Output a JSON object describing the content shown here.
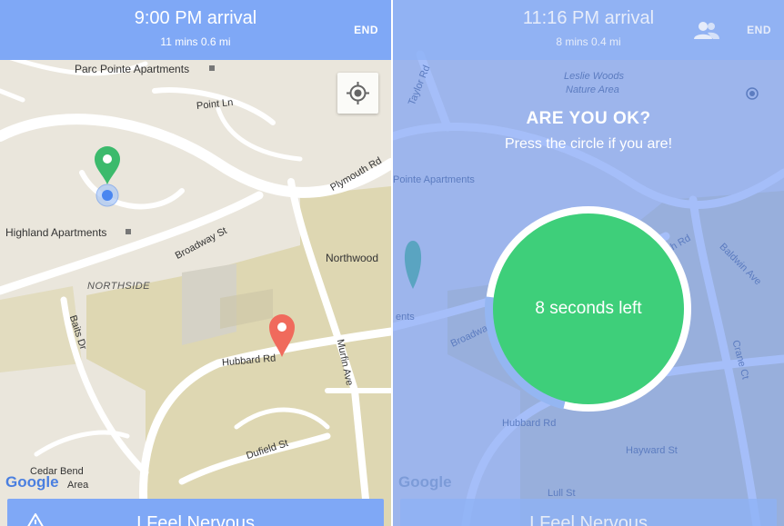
{
  "left": {
    "header": {
      "arrival": "9:00 PM arrival",
      "meta": "11 mins 0.6 mi",
      "end_label": "END"
    },
    "map_labels": {
      "parc_pointe": "Parc Pointe Apartments",
      "point_ln": "Point Ln",
      "plymouth_rd": "Plymouth Rd",
      "highland": "Highland Apartments",
      "broadway": "Broadway St",
      "northwood": "Northwood",
      "northside": "NORTHSIDE",
      "baits": "Baits Dr",
      "hubbard": "Hubbard Rd",
      "murfin": "Murfin Ave",
      "dufield": "Dufield St",
      "cedar_bend_1": "Cedar Bend",
      "cedar_bend_2": "Area"
    },
    "bottom": {
      "label": "I Feel Nervous"
    }
  },
  "right": {
    "header": {
      "arrival": "11:16 PM arrival",
      "meta": "8 mins 0.4 mi",
      "end_label": "END"
    },
    "map_labels": {
      "leslie_1": "Leslie Woods",
      "leslie_2": "Nature Area",
      "pointe": "Pointe Apartments",
      "taylor": "Taylor Rd",
      "hubbard": "Hubbard Rd",
      "hayward": "Hayward St",
      "broadway": "Broadway",
      "ents": "ents",
      "baldwin": "Baldwin Ave",
      "crane": "Crane Ct",
      "th_rd": "th Rd",
      "lull": "Lull St"
    },
    "dialog": {
      "title": "ARE YOU OK?",
      "subtitle": "Press the circle if you are!",
      "timer": "8 seconds left"
    },
    "timer_remaining_fraction": 0.77,
    "bottom": {
      "label": "I Feel Nervous"
    }
  },
  "google_logo": "Google",
  "colors": {
    "header_blue": "#7fa8f6",
    "timer_green": "#3ecf7a",
    "origin_pin": "#3cba6c",
    "destination_pin": "#f06a5c",
    "map_bg": "#eae6dc",
    "land_tan": "#ded7b2"
  }
}
